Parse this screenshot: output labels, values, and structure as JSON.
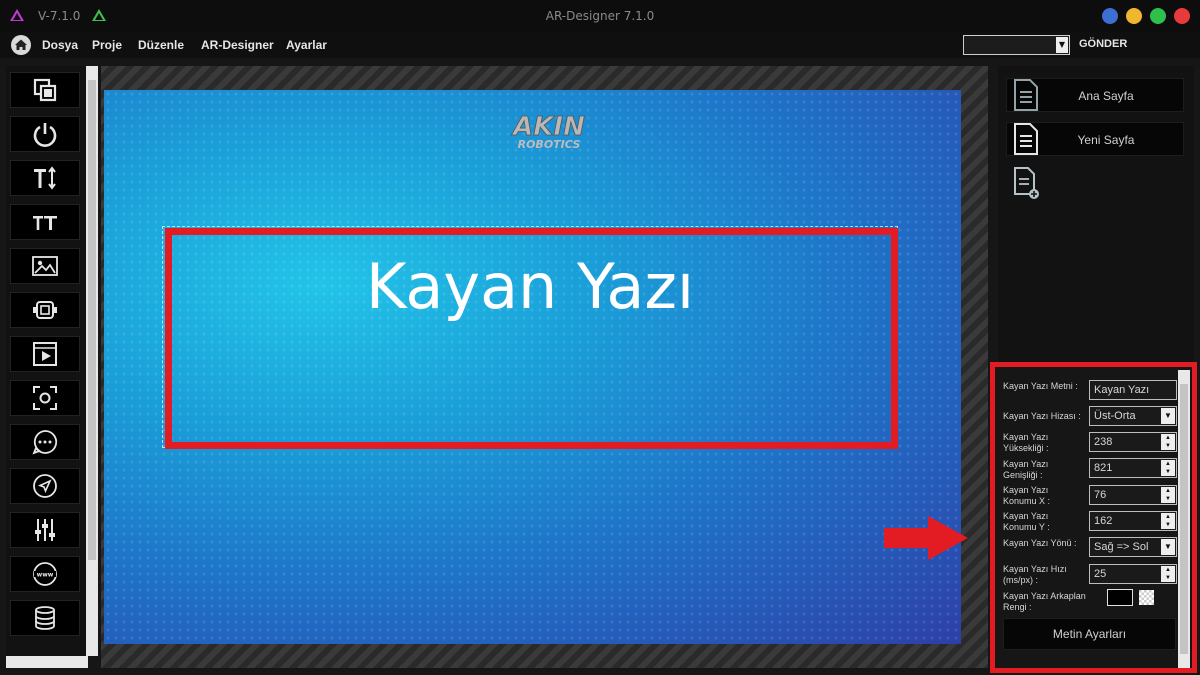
{
  "window": {
    "version": "V-7.1.0",
    "title": "AR-Designer 7.1.0",
    "controls": [
      {
        "name": "minimize-button",
        "color": "#3b6fd1"
      },
      {
        "name": "restore-button",
        "color": "#f1b72c"
      },
      {
        "name": "maximize-button",
        "color": "#2fbf4a"
      },
      {
        "name": "close-button",
        "color": "#e83a3a"
      }
    ]
  },
  "menu": {
    "items": [
      "Dosya",
      "Proje",
      "Düzenle",
      "AR-Designer",
      "Ayarlar"
    ],
    "send_label": "GÖNDER"
  },
  "tools": [
    "layers-icon",
    "power-icon",
    "text-resize-icon",
    "font-size-icon",
    "image-icon",
    "video-camera-icon",
    "film-icon",
    "screenshot-icon",
    "chat-icon",
    "navigation-icon",
    "sliders-icon",
    "web-icon",
    "database-icon"
  ],
  "canvas": {
    "brand_top": "AKIN",
    "brand_bottom": "ROBOTICS",
    "marquee_text": "Kayan Yazı"
  },
  "pages": {
    "items": [
      "Ana Sayfa",
      "Yeni Sayfa"
    ]
  },
  "properties": {
    "text_label": "Kayan Yazı Metni :",
    "text_value": "Kayan Yazı",
    "align_label": "Kayan Yazı Hizası :",
    "align_value": "Üst-Orta",
    "height_label": "Kayan Yazı Yüksekliği :",
    "height_value": "238",
    "width_label": "Kayan Yazı Genişliği :",
    "width_value": "821",
    "x_label": "Kayan Yazı Konumu X :",
    "x_value": "76",
    "y_label": "Kayan Yazı Konumu Y :",
    "y_value": "162",
    "direction_label": "Kayan Yazı Yönü :",
    "direction_value": "Sağ => Sol",
    "speed_label": "Kayan Yazı Hızı (ms/px) :",
    "speed_value": "25",
    "bg_label": "Kayan Yazı Arkaplan Rengi :",
    "bg_color": "#000000",
    "text_settings_button": "Metin Ayarları"
  },
  "accent": "#e31b23"
}
